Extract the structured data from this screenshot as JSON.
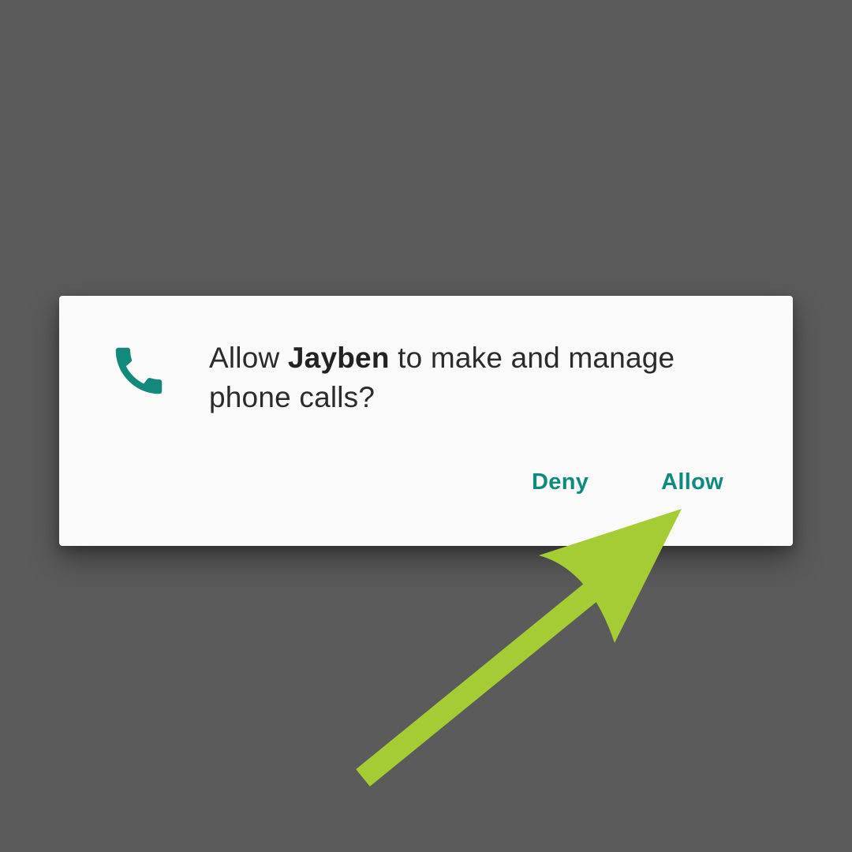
{
  "dialog": {
    "message_prefix": "Allow ",
    "app_name": "Jayben",
    "message_suffix": " to make and manage phone calls?",
    "icon": "phone-icon",
    "deny_label": "Deny",
    "allow_label": "Allow"
  },
  "colors": {
    "background": "#5b5b5b",
    "dialog": "#fafafa",
    "accent": "#0f8a7e",
    "icon": "#12897c",
    "arrow": "#a4cc35"
  },
  "annotation": {
    "icon": "arrow-icon",
    "points_to": "allow-button"
  }
}
